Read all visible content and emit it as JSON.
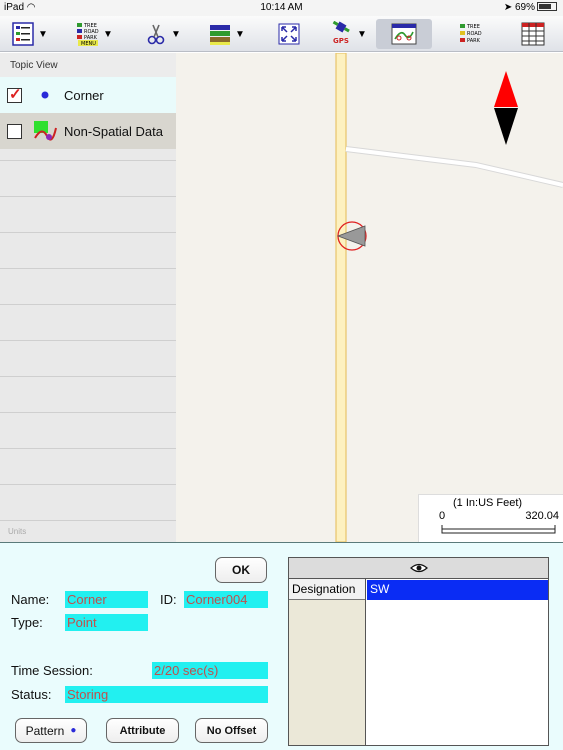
{
  "status_bar": {
    "device": "iPad",
    "time": "10:14 AM",
    "battery": "69%"
  },
  "toolbar": {
    "icons": [
      "layers-icon",
      "tree-menu-icon",
      "scissors-icon",
      "layer-stack-icon",
      "zoom-extent-icon",
      "gps-icon",
      "map-view-icon",
      "tree-toggle-icon",
      "table-icon"
    ],
    "tree_menu_badge": "MENU",
    "gps_badge": "GPS",
    "tree_legend": [
      "TREE",
      "ROAD",
      "PARK"
    ]
  },
  "sidebar": {
    "title": "Topic View",
    "layers": [
      {
        "label": "Corner",
        "checked": true
      },
      {
        "label": "Non-Spatial Data",
        "checked": false
      }
    ],
    "faint_units": "Units"
  },
  "map": {
    "scale_title": "(1 In:US Feet)",
    "scale_min": "0",
    "scale_max": "320.04",
    "colors": {
      "road": "#fdf1c0",
      "road_edge": "#e8c46a",
      "compass_north": "#ff0000",
      "compass_south": "#000000"
    }
  },
  "panel": {
    "ok_label": "OK",
    "name_label": "Name:",
    "name_value": "Corner",
    "id_label": "ID:",
    "id_value": "Corner004",
    "type_label": "Type:",
    "type_value": "Point",
    "time_session_label": "Time Session:",
    "time_session_value": "2/20 sec(s)",
    "status_label": "Status:",
    "status_value": "Storing",
    "pattern_label": "Pattern",
    "attribute_label": "Attribute",
    "offset_label": "No Offset",
    "attributes": [
      {
        "key": "Designation",
        "value": "SW"
      }
    ]
  }
}
